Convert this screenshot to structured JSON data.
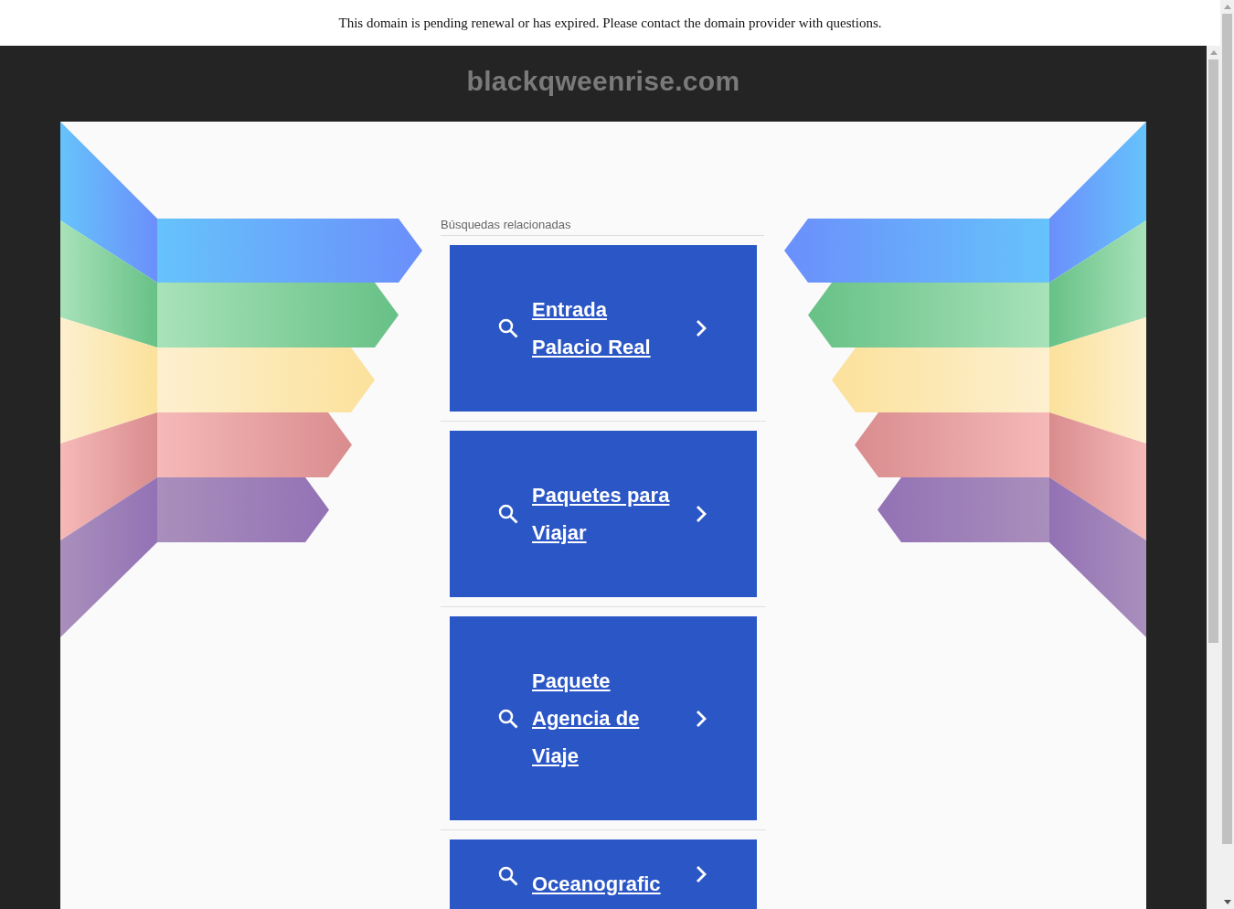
{
  "notice_bar": {
    "text": "This domain is pending renewal or has expired. Please contact the domain provider with questions."
  },
  "site_title": "blackqweenrise.com",
  "related_searches": {
    "heading": "Búsquedas relacionadas",
    "links": [
      {
        "label": "Entrada Palacio Real"
      },
      {
        "label": "Paquetes para Viajar"
      },
      {
        "label": "Paquete Agencia de Viaje"
      },
      {
        "label": "Oceanografic"
      }
    ]
  }
}
